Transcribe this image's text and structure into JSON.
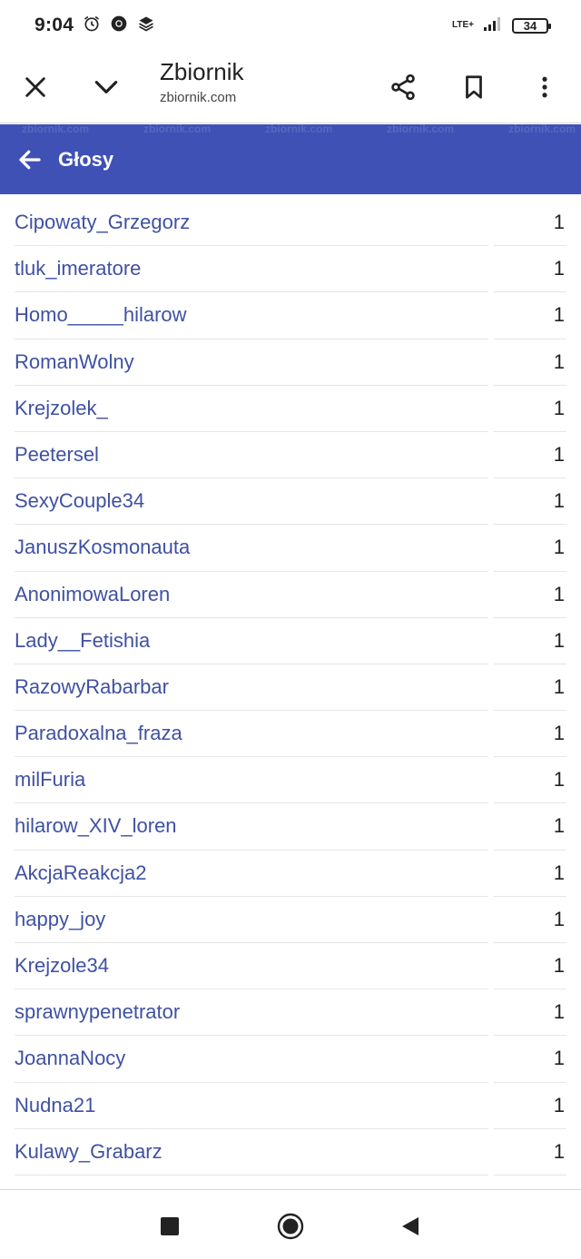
{
  "status_bar": {
    "time": "9:04",
    "icons_left": [
      "alarm-icon",
      "chrome-icon",
      "layers-icon"
    ],
    "network": "LTE+",
    "battery": "34"
  },
  "toolbar": {
    "title": "Zbiornik",
    "subtitle": "zbiornik.com",
    "icons": [
      "close-icon",
      "chevron-down-icon",
      "share-icon",
      "bookmark-icon",
      "more-vert-icon"
    ]
  },
  "header": {
    "title": "Głosy",
    "back_icon": "arrow-left-icon",
    "accent_color": "#3f51b5"
  },
  "votes": [
    {
      "name": "Cipowaty_Grzegorz",
      "count": "1"
    },
    {
      "name": "tluk_imeratore",
      "count": "1"
    },
    {
      "name": "Homo_____hilarow",
      "count": "1"
    },
    {
      "name": "RomanWolny",
      "count": "1"
    },
    {
      "name": "Krejzolek_",
      "count": "1"
    },
    {
      "name": "Peetersel",
      "count": "1"
    },
    {
      "name": "SexyCouple34",
      "count": "1"
    },
    {
      "name": "JanuszKosmonauta",
      "count": "1"
    },
    {
      "name": "AnonimowaLoren",
      "count": "1"
    },
    {
      "name": "Lady__Fetishia",
      "count": "1"
    },
    {
      "name": "RazowyRabarbar",
      "count": "1"
    },
    {
      "name": "Paradoxalna_fraza",
      "count": "1"
    },
    {
      "name": "milFuria",
      "count": "1"
    },
    {
      "name": "hilarow_XIV_loren",
      "count": "1"
    },
    {
      "name": "AkcjaReakcja2",
      "count": "1"
    },
    {
      "name": "happy_joy",
      "count": "1"
    },
    {
      "name": "Krejzole34",
      "count": "1"
    },
    {
      "name": "sprawnypenetrator",
      "count": "1"
    },
    {
      "name": "JoannaNocy",
      "count": "1"
    },
    {
      "name": "Nudna21",
      "count": "1"
    },
    {
      "name": "Kulawy_Grabarz",
      "count": "1"
    }
  ],
  "nav_bar": {
    "icons": [
      "recents-square-icon",
      "home-circle-icon",
      "back-triangle-icon"
    ]
  },
  "colors": {
    "link": "#3f51a3",
    "header": "#3f51b5"
  }
}
